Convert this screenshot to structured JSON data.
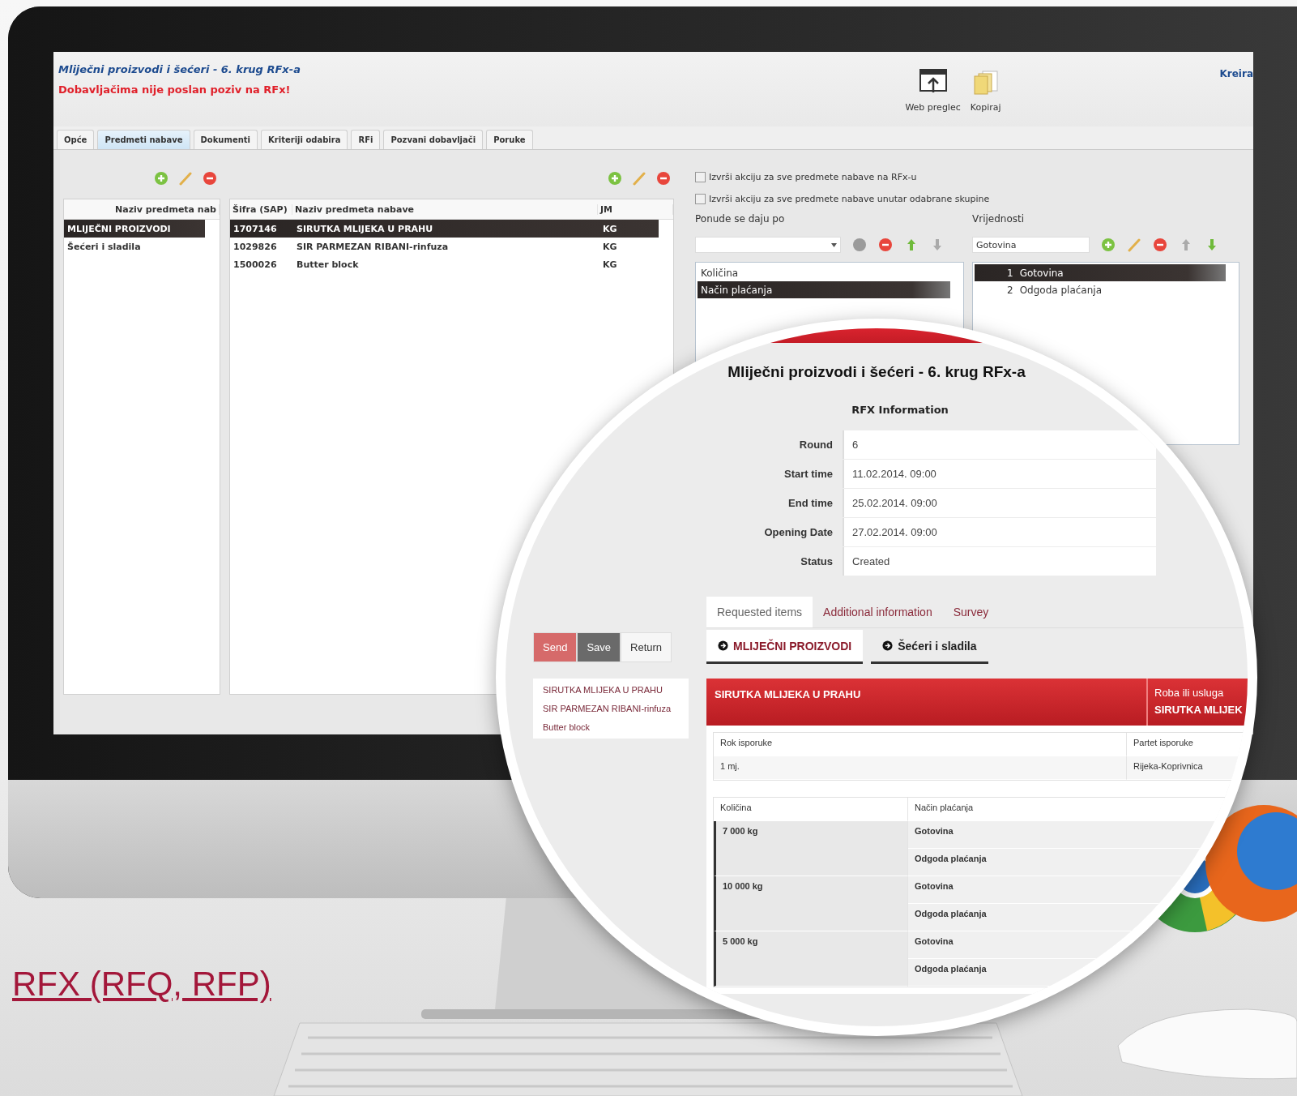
{
  "app": {
    "title": "Mliječni proizvodi i šećeri - 6. krug RFx-a",
    "warning": "Dobavljačima nije poslan poziv na RFx!",
    "toolbar": [
      {
        "kind": "web",
        "label": "Web preglec"
      },
      {
        "kind": "copy",
        "label": "Kopiraj"
      }
    ],
    "user_link": "Kreira",
    "tabs": [
      {
        "label": "Opće",
        "selected": false
      },
      {
        "label": "Predmeti nabave",
        "selected": true
      },
      {
        "label": "Dokumenti",
        "selected": false
      },
      {
        "label": "Kriteriji odabira",
        "selected": false
      },
      {
        "label": "RFi",
        "selected": false
      },
      {
        "label": "Pozvani dobavljači",
        "selected": false
      },
      {
        "label": "Poruke",
        "selected": false
      }
    ],
    "groups": {
      "column": "Naziv predmeta nab",
      "rows": [
        {
          "label": "MLIJEČNI PROIZVODI",
          "selected": true
        },
        {
          "label": "Šećeri i sladila",
          "selected": false
        }
      ]
    },
    "items": {
      "columns": [
        "Šifra (SAP)",
        "Naziv predmeta nabave",
        "JM"
      ],
      "rows": [
        {
          "code": "1707146",
          "name": "SIRUTKA MLIJEKA U PRAHU",
          "unit": "KG",
          "selected": true
        },
        {
          "code": "1029826",
          "name": "SIR PARMEZAN RIBANI-rinfuza",
          "unit": "KG",
          "selected": false
        },
        {
          "code": "1500026",
          "name": "Butter block",
          "unit": "KG",
          "selected": false
        }
      ]
    },
    "options": [
      {
        "label": "Izvrši akciju za sve predmete nabave na RFx-u",
        "checked": false
      },
      {
        "label": "Izvrši akciju za sve predmete nabave unutar odabrane skupine",
        "checked": false
      }
    ],
    "offer_by": {
      "label": "Ponude se daju po",
      "items": [
        {
          "label": "Količina",
          "selected": false
        },
        {
          "label": "Način plaćanja",
          "selected": true
        }
      ]
    },
    "values": {
      "label": "Vrijednosti",
      "value": "Gotovina",
      "items": [
        {
          "number": "1",
          "label": "Gotovina",
          "selected": true
        },
        {
          "number": "2",
          "label": "Odgoda plaćanja",
          "selected": false
        }
      ]
    }
  },
  "preview": {
    "title": "Mliječni proizvodi i šećeri - 6. krug RFx-a",
    "section": "RFX Information",
    "fields": [
      {
        "label": "Round",
        "value": "6"
      },
      {
        "label": "Start time",
        "value": "11.02.2014. 09:00"
      },
      {
        "label": "End time",
        "value": "25.02.2014. 09:00"
      },
      {
        "label": "Opening Date",
        "value": "27.02.2014. 09:00"
      },
      {
        "label": "Status",
        "value": "Created"
      }
    ],
    "tabs": [
      {
        "label": "Requested items",
        "selected": true
      },
      {
        "label": "Additional information",
        "selected": false
      },
      {
        "label": "Survey",
        "selected": false
      }
    ],
    "actions": [
      {
        "kind": "send",
        "label": "Send"
      },
      {
        "kind": "save",
        "label": "Save"
      },
      {
        "kind": "return",
        "label": "Return"
      }
    ],
    "item_links": [
      "SIRUTKA MLIJEKA U PRAHU",
      "SIR PARMEZAN RIBANI-rinfuza",
      "Butter block"
    ],
    "groups": [
      {
        "label": "MLIJEČNI PROIZVODI",
        "selected": true
      },
      {
        "label": "Šećeri i sladila",
        "selected": false
      }
    ],
    "item": {
      "name": "SIRUTKA MLIJEKA U PRAHU",
      "type_label": "Roba ili usluga",
      "type_value": "SIRUTKA MLIJEK"
    },
    "delivery": {
      "columns": [
        "Rok isporuke",
        "Partet isporuke"
      ],
      "values": [
        "1 mj.",
        "Rijeka-Koprivnica"
      ]
    },
    "pricing": {
      "columns": [
        "Količina",
        "Način plaćanja"
      ],
      "rows": [
        {
          "quantity": "7 000 kg",
          "payments": [
            "Gotovina",
            "Odgoda plaćanja"
          ]
        },
        {
          "quantity": "10 000 kg",
          "payments": [
            "Gotovina",
            "Odgoda plaćanja"
          ]
        },
        {
          "quantity": "5 000 kg",
          "payments": [
            "Gotovina",
            "Odgoda plaćanja"
          ]
        }
      ]
    }
  },
  "link": "RFX (RFQ, RFP)"
}
